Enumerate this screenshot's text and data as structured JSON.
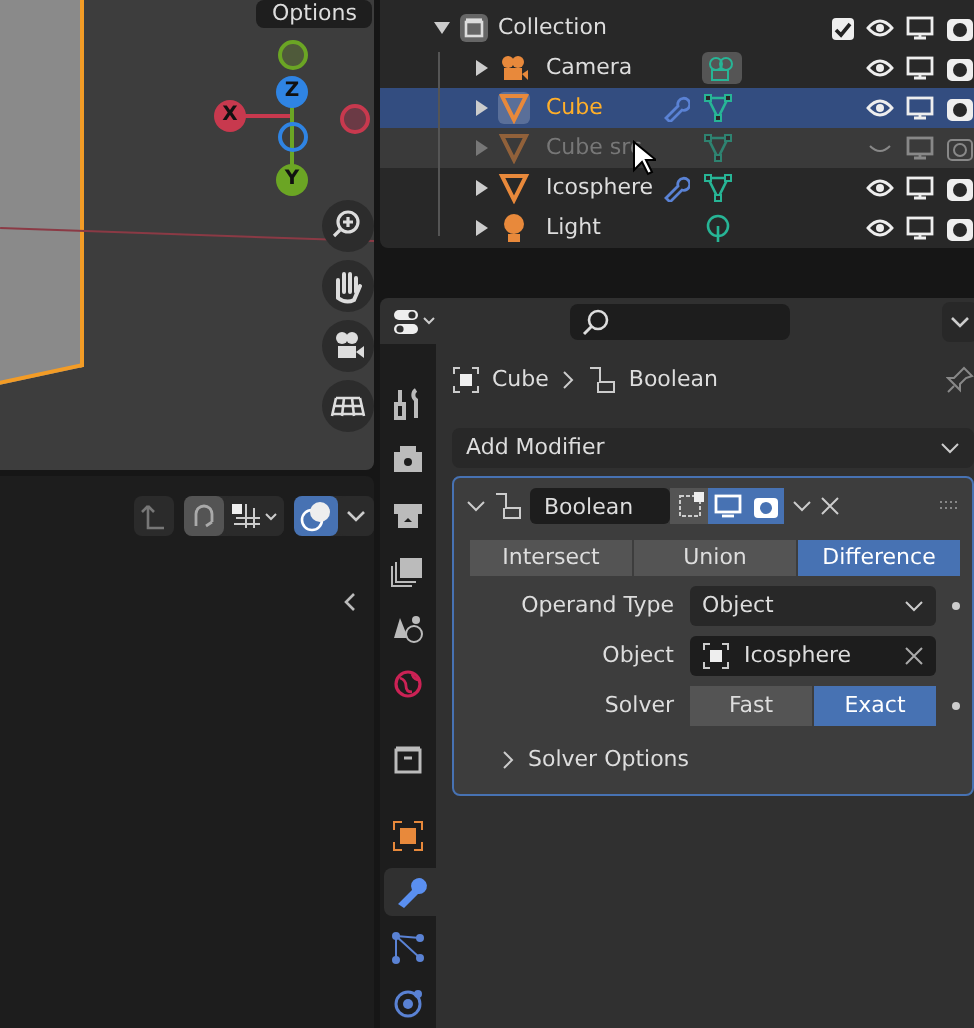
{
  "viewport": {
    "header_button": "Options",
    "axes": [
      {
        "label": "X",
        "color": "#c8394e"
      },
      {
        "label": "Z",
        "color": "#2f84e3"
      },
      {
        "label": "Y",
        "color": "#6ba524"
      }
    ]
  },
  "bottom_toolbar": {
    "overlay_on": true
  },
  "outliner": {
    "items": [
      {
        "label": "Collection",
        "kind": "collection",
        "expanded": true,
        "checked": true,
        "children": [
          {
            "label": "Camera",
            "kind": "camera",
            "selected": false,
            "disabled": false,
            "expanded": false,
            "modifier": false
          },
          {
            "label": "Cube",
            "kind": "mesh",
            "selected": true,
            "disabled": false,
            "expanded": false,
            "modifier": true
          },
          {
            "label": "Cube src",
            "kind": "mesh",
            "selected": false,
            "disabled": true,
            "expanded": false,
            "modifier": false
          },
          {
            "label": "Icosphere",
            "kind": "mesh",
            "selected": false,
            "disabled": false,
            "expanded": false,
            "modifier": true
          },
          {
            "label": "Light",
            "kind": "light",
            "selected": false,
            "disabled": false,
            "expanded": false,
            "modifier": false
          }
        ]
      }
    ]
  },
  "properties": {
    "tabs": [
      {
        "kind": "tool",
        "selected": false
      },
      {
        "kind": "render",
        "selected": false
      },
      {
        "kind": "output",
        "selected": false
      },
      {
        "kind": "view_layer",
        "selected": false
      },
      {
        "kind": "scene",
        "selected": false
      },
      {
        "kind": "world",
        "selected": false
      },
      {
        "kind": "collection",
        "selected": false
      },
      {
        "kind": "object",
        "selected": false
      },
      {
        "kind": "modifier",
        "selected": true
      },
      {
        "kind": "particles",
        "selected": false
      },
      {
        "kind": "physics",
        "selected": false
      }
    ],
    "breadcrumb": [
      "Cube",
      "Boolean"
    ],
    "add_button": "Add Modifier",
    "modifier": {
      "name": "Boolean",
      "expanded": true,
      "edit_mode": false,
      "viewport": true,
      "render": true,
      "operations": [
        {
          "label": "Intersect",
          "selected": false
        },
        {
          "label": "Union",
          "selected": false
        },
        {
          "label": "Difference",
          "selected": true
        }
      ],
      "fields": [
        {
          "label": "Operand Type",
          "kind": "dropdown",
          "value": "Object"
        },
        {
          "label": "Object",
          "kind": "object",
          "value": "Icosphere"
        },
        {
          "label": "Solver",
          "kind": "choice",
          "options": [
            {
              "label": "Fast",
              "selected": false
            },
            {
              "label": "Exact",
              "selected": true
            }
          ]
        }
      ],
      "subpanel": {
        "label": "Solver Options",
        "expanded": false
      }
    }
  }
}
